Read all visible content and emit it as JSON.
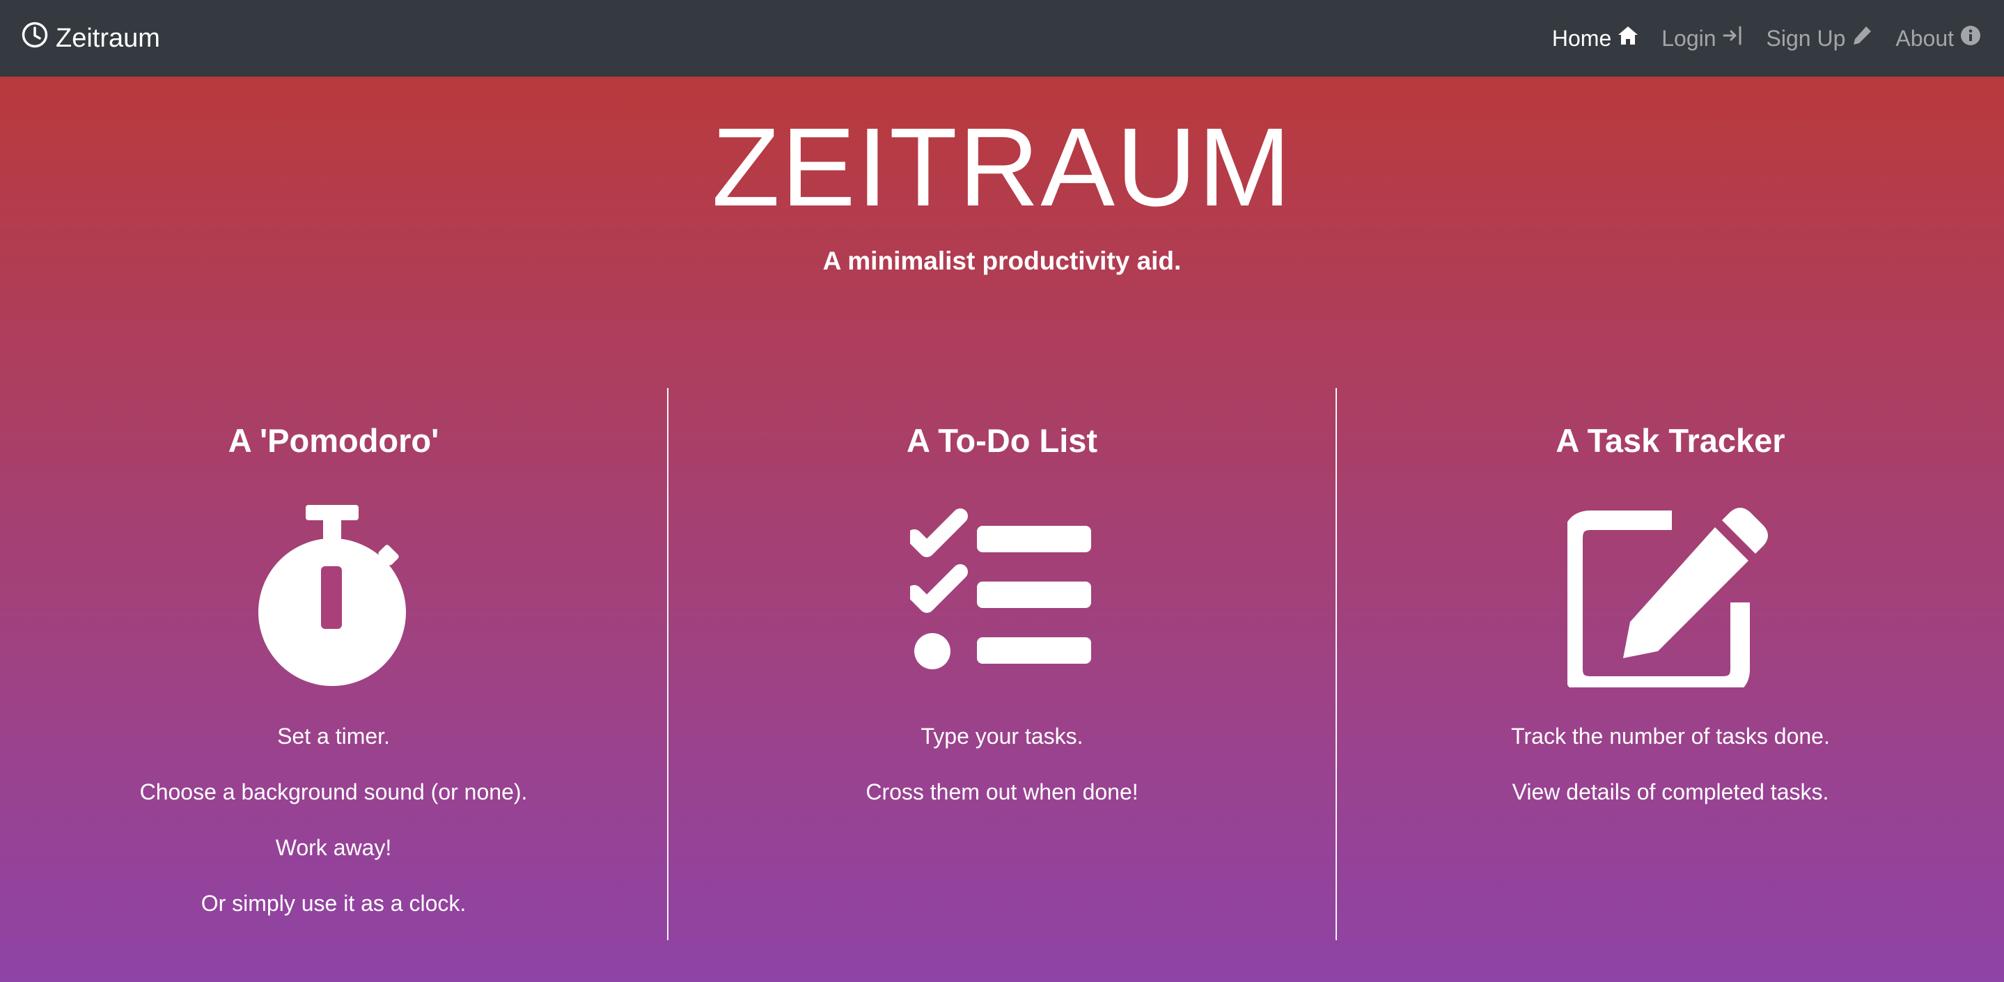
{
  "navbar": {
    "brand_label": "Zeitraum",
    "brand_icon": "clock-icon",
    "items": [
      {
        "label": "Home",
        "icon": "home-icon",
        "active": true
      },
      {
        "label": "Login",
        "icon": "login-icon",
        "active": false
      },
      {
        "label": "Sign Up",
        "icon": "pencil-icon",
        "active": false
      },
      {
        "label": "About",
        "icon": "info-icon",
        "active": false
      }
    ]
  },
  "hero": {
    "title": "ZEITRAUM",
    "subtitle": "A minimalist productivity aid."
  },
  "features": [
    {
      "title": "A 'Pomodoro'",
      "icon": "stopwatch-icon",
      "lines": [
        "Set a timer.",
        "Choose a background sound (or none).",
        "Work away!",
        "Or simply use it as a clock."
      ]
    },
    {
      "title": "A To-Do List",
      "icon": "checklist-icon",
      "lines": [
        "Type your tasks.",
        "Cross them out when done!"
      ]
    },
    {
      "title": "A Task Tracker",
      "icon": "edit-icon",
      "lines": [
        "Track the number of tasks done.",
        "View details of completed tasks."
      ]
    }
  ],
  "colors": {
    "navbar_bg": "#343a40",
    "gradient_top": "#b93a3c",
    "gradient_bottom": "#8e43a6",
    "text": "#ffffff"
  }
}
